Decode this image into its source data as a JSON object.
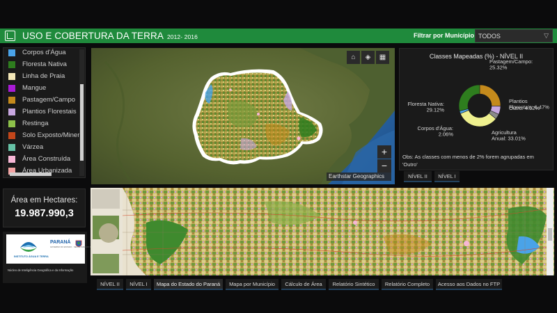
{
  "header": {
    "title": "USO E COBERTURA DA TERRA",
    "years": "2012- 2016",
    "filter_label": "Filtrar por Município",
    "filter_value": "TODOS",
    "accent": "#1f8a3c"
  },
  "legend": {
    "items": [
      {
        "label": "Corpos d'Água",
        "color": "#4aa3e8"
      },
      {
        "label": "Floresta Nativa",
        "color": "#2e7d1e"
      },
      {
        "label": "Linha de Praia",
        "color": "#f3e7b8"
      },
      {
        "label": "Mangue",
        "color": "#a91bd6"
      },
      {
        "label": "Pastagem/Campo",
        "color": "#c48a1c"
      },
      {
        "label": "Plantios Florestais",
        "color": "#c7a7e0"
      },
      {
        "label": "Restinga",
        "color": "#8dc14a"
      },
      {
        "label": "Solo Exposto/Mineração",
        "color": "#c2461a"
      },
      {
        "label": "Várzea",
        "color": "#66c2a6"
      },
      {
        "label": "Área Construída",
        "color": "#f7b7d6"
      },
      {
        "label": "Área Urbanizada",
        "color": "#f2a2a2"
      }
    ]
  },
  "area": {
    "label": "Área em Hectares:",
    "value": "19.987.990,3"
  },
  "logos": {
    "iat_name": "INSTITUTO ÁGUA E TERRA",
    "parana": "PARANÁ",
    "parana_sub": "GOVERNO DO ESTADO · SECRETARIA DO DESENVOLVIMENTO SUSTENTÁVEL",
    "caption": "Núcleo de Inteligência Geográfica e da Informação"
  },
  "map": {
    "attribution": "Earthstar Geographics",
    "zoom_in": "+",
    "zoom_out": "−"
  },
  "chart_title": "Classes Mapeadas (%) - NÍVEL II",
  "chart_data": {
    "type": "pie",
    "categories": [
      "Pastagem/Campo",
      "Plantios Florestais",
      "Outro",
      "Agricultura Anual",
      "Corpos d'Água",
      "Floresta Nativa"
    ],
    "values": [
      25.32,
      6.47,
      4.02,
      33.01,
      2.06,
      29.12
    ],
    "colors": [
      "#c48a1c",
      "#c7a7e0",
      "#8a8a8a",
      "#eef08e",
      "#4aa3e8",
      "#2e7d1e"
    ],
    "labels": [
      {
        "name": "Pastagem/Campo",
        "value": "25.32%"
      },
      {
        "name": "Plantios Florestais",
        "value": "6.47%"
      },
      {
        "name": "Outro",
        "value": "4.02%"
      },
      {
        "name": "Agricultura Anual",
        "value": "33.01%"
      },
      {
        "name": "Corpos d'Água",
        "value": "2.06%"
      },
      {
        "name": "Floresta Nativa",
        "value": "29.12%"
      }
    ]
  },
  "chart_note": "Obs: As classes com menos de 2% forem agrupadas em 'Outro'",
  "chart_tabs": [
    "NÍVEL II",
    "NÍVEL I"
  ],
  "bottom_tabs": [
    "NÍVEL II",
    "NÍVEL I",
    "Mapa do Estado do Paraná",
    "Mapa por Município",
    "Cálculo de Área",
    "Relatório Sintético",
    "Relatório Completo",
    "Acesso aos Dados no FTP"
  ]
}
